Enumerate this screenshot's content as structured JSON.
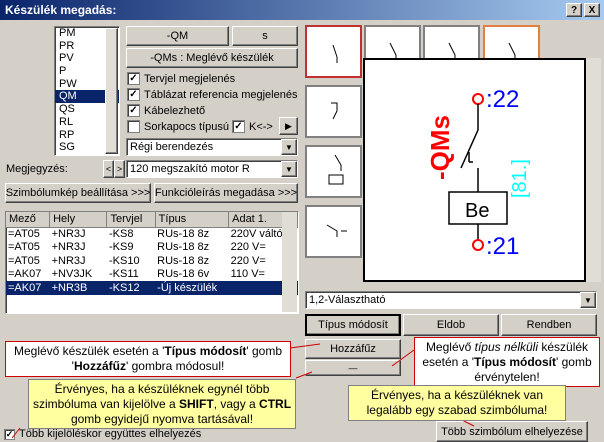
{
  "window": {
    "title": "Készülék megadás:",
    "help": "?",
    "close": "X"
  },
  "type_list": [
    "PM",
    "PR",
    "PV",
    "P",
    "PW",
    "QM",
    "QS",
    "RL",
    "RP",
    "SG"
  ],
  "selected_type": "QM",
  "buttons": {
    "qm": "-QM",
    "s": "s",
    "qms_existing": "-QMs :  Meglévő készülék",
    "symbol_settings": "Szimbólumkép beállítása >>>",
    "function_desc": "Funkcióleírás megadása >>>",
    "type_modify": "Típus módosít",
    "eldob": "Eldob",
    "rendben": "Rendben",
    "hozzafuz": "Hozzáfűz",
    "blank": "—",
    "multi_place": "Több szimbólum elhelyezése",
    "prev": "<",
    "next": ">",
    "play": "▶"
  },
  "checks": {
    "tervjel": "Tervjel megjelenés",
    "tablazat": "Táblázat referencia megjelenés",
    "kabel": "Kábelezhető",
    "sorkapocs": "Sorkapocs típusú",
    "k_arrow": "K<->",
    "multi_select": "Több kijelöléskor együttes elhelyezés"
  },
  "combo_regi": "Régi berendezés",
  "megjegyzes_label": "Megjegyzés:",
  "megjegyzes_value": "120 megszakító motor R",
  "table": {
    "headers": [
      "Mező",
      "Hely",
      "Tervjel",
      "Típus",
      "Adat 1."
    ],
    "rows": [
      [
        "=AT05",
        "+NR3J",
        "-KS8",
        "RUs-18 8z",
        "220V váltó"
      ],
      [
        "=AT05",
        "+NR3J",
        "-KS9",
        "RUs-18 8z",
        "220 V="
      ],
      [
        "=AT05",
        "+NR3J",
        "-KS10",
        "RUs-18 8z",
        "220 V="
      ],
      [
        "=AK07",
        "+NV3JK",
        "-KS11",
        "RUs-18 6v",
        "110 V="
      ],
      [
        "=AK07",
        "+NR3B",
        "-KS12",
        "-Új készülék",
        ""
      ]
    ],
    "selected_row": 4
  },
  "symbol": {
    "top": ":22",
    "bottom": ":21",
    "label": "-QMs",
    "ref": "[81.]",
    "box": "Be"
  },
  "combo_symbol": "1,2-Választható",
  "notes": {
    "n1a": "Meglévő készülék esetén a ",
    "n1b": "Típus módosít",
    "n1c": " gomb ",
    "n1d": "Hozzáfűz",
    "n1e": " gombra módosul!",
    "n2a": "Meglévő ",
    "n2b": "típus nélküli",
    "n2c": " készülék esetén a ",
    "n2d": "Típus módosít",
    "n2e": " gomb érvénytelen!",
    "n3a": "Érvényes, ha a készüléknek egynél több szimbóluma van kijelölve a ",
    "n3b": "SHIFT",
    "n3c": ", vagy a ",
    "n3d": "CTRL",
    "n3e": " gomb egyidejű nyomva tartásával!",
    "n4": "Érvényes, ha a készüléknek van legalább egy szabad szimbóluma!"
  },
  "colors": {
    "title_start": "#0a246a",
    "selection": "#0a246a",
    "symbol_red": "#ff0000",
    "symbol_blue": "#0000ff",
    "symbol_cyan": "#00ffff"
  }
}
